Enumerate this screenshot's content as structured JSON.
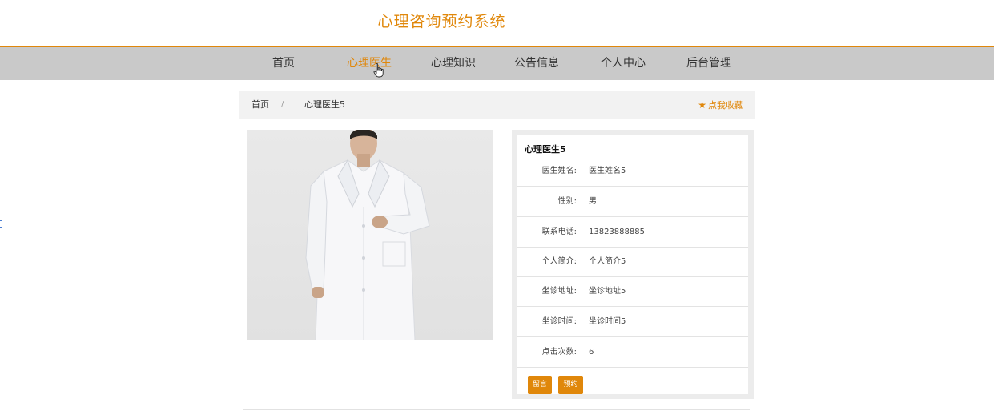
{
  "site": {
    "title": "心理咨询预约系统"
  },
  "nav": {
    "items": [
      {
        "label": "首页"
      },
      {
        "label": "心理医生"
      },
      {
        "label": "心理知识"
      },
      {
        "label": "公告信息"
      },
      {
        "label": "个人中心"
      },
      {
        "label": "后台管理"
      }
    ],
    "active_color": "#e0870a"
  },
  "breadcrumb": {
    "home": "首页",
    "separator": "/",
    "current": "心理医生5"
  },
  "favorite": {
    "icon": "star-icon",
    "label": "点我收藏"
  },
  "doctor": {
    "title": "心理医生5",
    "fields": [
      {
        "label": "医生姓名:",
        "value": "医生姓名5"
      },
      {
        "label": "性别:",
        "value": "男"
      },
      {
        "label": "联系电话:",
        "value": "13823888885"
      },
      {
        "label": "个人简介:",
        "value": "个人简介5"
      },
      {
        "label": "坐诊地址:",
        "value": "坐诊地址5"
      },
      {
        "label": "坐诊时间:",
        "value": "坐诊时间5"
      },
      {
        "label": "点击次数:",
        "value": "6"
      }
    ]
  },
  "actions": {
    "message": "留言",
    "book": "预约"
  },
  "colors": {
    "accent": "#e0870a",
    "nav_bg": "#c9c9c9",
    "breadcrumb_bg": "#f2f2f2"
  }
}
